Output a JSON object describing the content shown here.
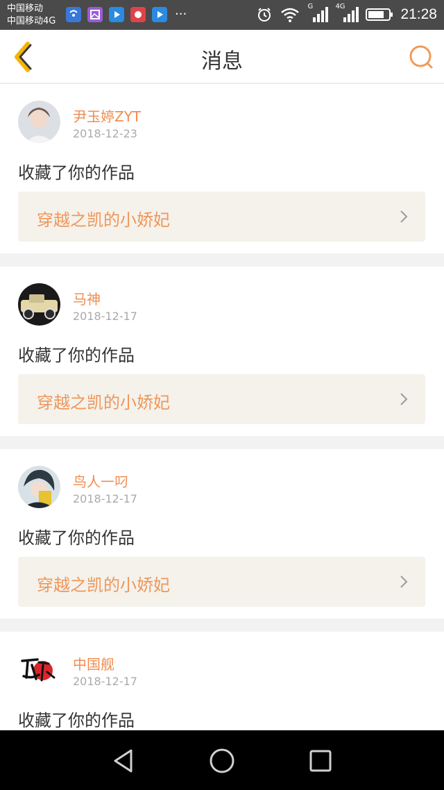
{
  "status_bar": {
    "carrier_1": "中国移动",
    "carrier_2": "中国移动4G",
    "network_label_1": "G",
    "network_label_2": "4G",
    "time": "21:28",
    "more": "···"
  },
  "header": {
    "title": "消息",
    "back_icon": "chevron-left-icon",
    "search_icon": "search-icon"
  },
  "messages": [
    {
      "user": "尹玉婷ZYT",
      "date": "2018-12-23",
      "action": "收藏了你的作品",
      "work_title": "穿越之凯的小娇妃"
    },
    {
      "user": "马神",
      "date": "2018-12-17",
      "action": "收藏了你的作品",
      "work_title": "穿越之凯的小娇妃"
    },
    {
      "user": "鸟人一叼",
      "date": "2018-12-17",
      "action": "收藏了你的作品",
      "work_title": "穿越之凯的小娇妃"
    },
    {
      "user": "中国舰",
      "date": "2018-12-17",
      "action": "收藏了你的作品",
      "work_title": ""
    }
  ],
  "colors": {
    "accent": "#f08c50",
    "link_bg": "#f4f2eb",
    "divider": "#f2f2f2"
  }
}
